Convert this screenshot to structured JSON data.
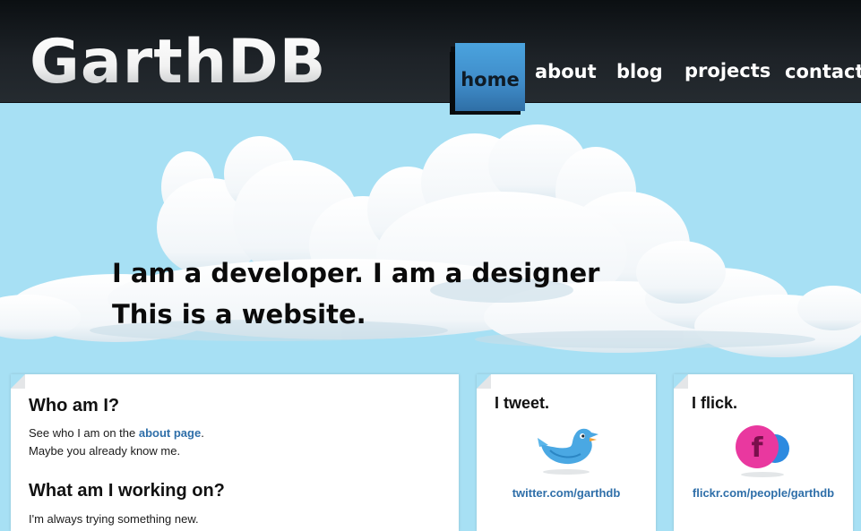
{
  "header": {
    "logo_text": "GarthDB",
    "nav": [
      "home",
      "about",
      "blog",
      "projects",
      "contact"
    ],
    "active": "home"
  },
  "hero": {
    "line1": "I am a developer. I am a designer",
    "line2": "This is a website."
  },
  "about_panel": {
    "heading1": "Who am I?",
    "text1_before": "See who I am on the ",
    "text1_link": "about page",
    "text1_after": ".",
    "text2": "Maybe you already know me.",
    "heading2": "What am I working on?",
    "text3": "I'm always trying something new."
  },
  "tweet_panel": {
    "heading": "I tweet.",
    "icon": "twitter-bird-icon",
    "link": "twitter.com/garthdb"
  },
  "flick_panel": {
    "heading": "I flick.",
    "icon": "flickr-icon",
    "link": "flickr.com/people/garthdb"
  },
  "colors": {
    "sky": "#a7e0f4",
    "header": "#1d2227",
    "nav_active": "#3f8bc8",
    "link": "#2f6fa9",
    "flickr_pink": "#e9389f",
    "flickr_blue": "#2d8ae0",
    "twitter_blue": "#4aa8e3"
  }
}
